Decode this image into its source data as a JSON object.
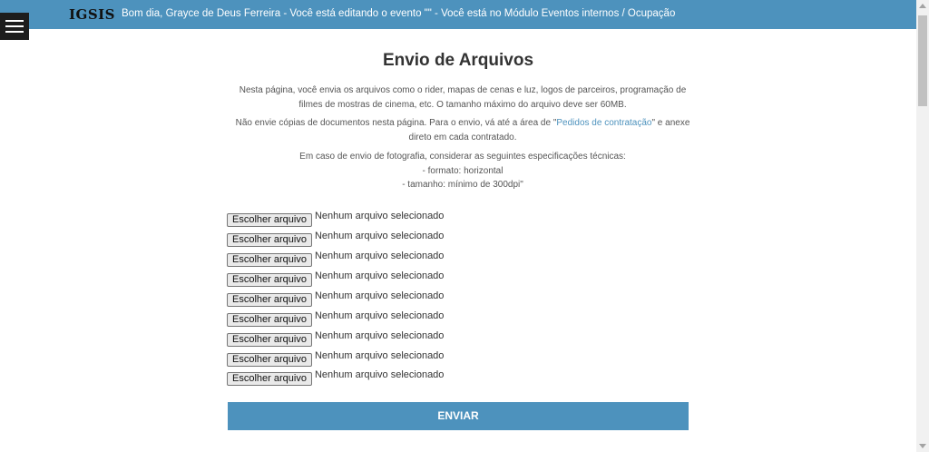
{
  "header": {
    "brand": "IGSIS",
    "greeting": "Bom dia, Grayce de Deus Ferreira - Você está editando o evento \"\" - Você está no Módulo Eventos internos / Ocupação"
  },
  "menu": {
    "icon": "hamburger-menu-icon"
  },
  "main": {
    "title": "Envio de Arquivos",
    "desc1_line1": "Nesta página, você envia os arquivos como o rider, mapas de cenas e luz, logos de parceiros, programação de",
    "desc1_line2": "filmes de mostras de cinema, etc. O tamanho máximo do arquivo deve ser 60MB.",
    "desc2_before": "Não envie cópias de documentos nesta página. Para o envio, vá até a área de \"",
    "desc2_link": "Pedidos de contratação",
    "desc2_after": "\" e anexe",
    "desc2_line2": "direto em cada contratado.",
    "desc3_line1": "Em caso de envio de fotografia, considerar as seguintes especificações técnicas:",
    "desc3_line2": "- formato: horizontal",
    "desc3_line3": "- tamanho: mínimo de 300dpi\""
  },
  "files": [
    {
      "button": "Escolher arquivo",
      "status": "Nenhum arquivo selecionado"
    },
    {
      "button": "Escolher arquivo",
      "status": "Nenhum arquivo selecionado"
    },
    {
      "button": "Escolher arquivo",
      "status": "Nenhum arquivo selecionado"
    },
    {
      "button": "Escolher arquivo",
      "status": "Nenhum arquivo selecionado"
    },
    {
      "button": "Escolher arquivo",
      "status": "Nenhum arquivo selecionado"
    },
    {
      "button": "Escolher arquivo",
      "status": "Nenhum arquivo selecionado"
    },
    {
      "button": "Escolher arquivo",
      "status": "Nenhum arquivo selecionado"
    },
    {
      "button": "Escolher arquivo",
      "status": "Nenhum arquivo selecionado"
    },
    {
      "button": "Escolher arquivo",
      "status": "Nenhum arquivo selecionado"
    }
  ],
  "submit": {
    "label": "ENVIAR"
  },
  "colors": {
    "accent": "#4d92bd",
    "menu_bg": "#1d1d1d"
  }
}
